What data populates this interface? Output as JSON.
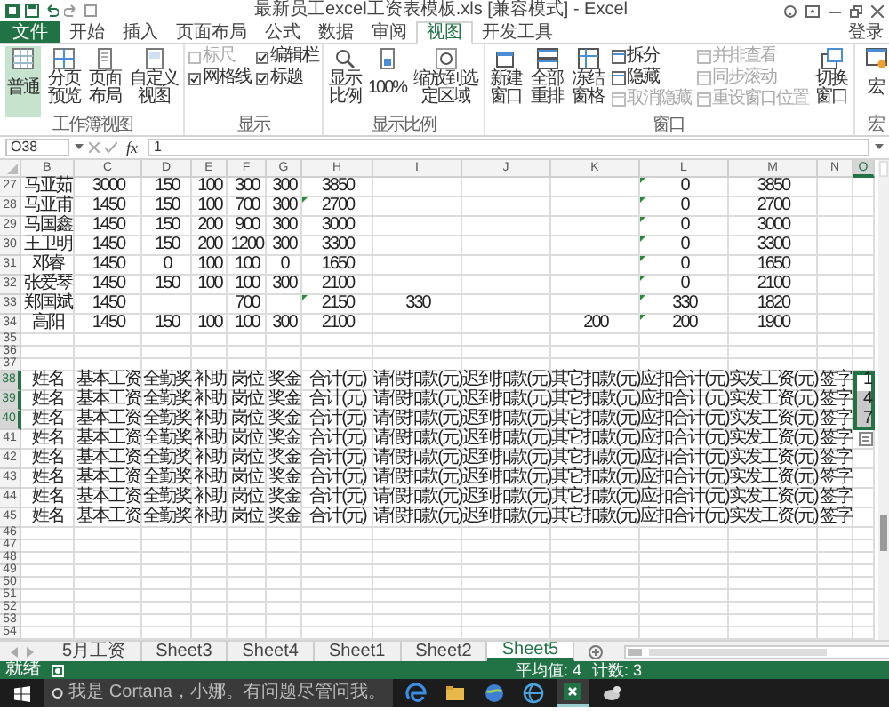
{
  "window": {
    "title": "最新员工excel工资表模板.xls  [兼容模式] - Excel"
  },
  "ribbon_tabs": [
    {
      "kind": "file",
      "label": "文件",
      "selected": false
    },
    {
      "kind": "tab",
      "label": "开始",
      "selected": false
    },
    {
      "kind": "tab",
      "label": "插入",
      "selected": false
    },
    {
      "kind": "tab",
      "label": "页面布局",
      "selected": false
    },
    {
      "kind": "tab",
      "label": "公式",
      "selected": false
    },
    {
      "kind": "tab",
      "label": "数据",
      "selected": false
    },
    {
      "kind": "tab",
      "label": "审阅",
      "selected": false
    },
    {
      "kind": "tab",
      "label": "视图",
      "selected": true
    },
    {
      "kind": "tab",
      "label": "开发工具",
      "selected": false
    }
  ],
  "account": "登录",
  "ribbon_groups": [
    {
      "items": [
        {
          "kind": "big",
          "label": "普通",
          "selected": true
        },
        {
          "kind": "big",
          "label": "分页预览",
          "selected": false
        },
        {
          "kind": "big",
          "label": "页面布局",
          "selected": false
        },
        {
          "kind": "big",
          "label": "自定义视图",
          "selected": false
        }
      ],
      "label": "工作簿视图"
    },
    {
      "items": [
        {
          "kind": "check",
          "label": "标尺",
          "checked": false,
          "disabled": true
        },
        {
          "kind": "check",
          "label": "网格线",
          "checked": true,
          "disabled": false
        },
        {
          "kind": "check",
          "label": "编辑栏",
          "checked": true,
          "disabled": false
        },
        {
          "kind": "check",
          "label": "标题",
          "checked": true,
          "disabled": false
        }
      ],
      "label": "显示"
    },
    {
      "items": [
        {
          "kind": "big",
          "label": "显示比例"
        },
        {
          "kind": "big",
          "label": "100%"
        },
        {
          "kind": "big",
          "label": "缩放到选定区域"
        }
      ],
      "label": "显示比例"
    },
    {
      "items": [
        {
          "kind": "big",
          "label": "新建窗口"
        },
        {
          "kind": "big",
          "label": "全部重排"
        },
        {
          "kind": "big",
          "label": "冻结窗格"
        },
        {
          "kind": "small",
          "label": "拆分",
          "disabled": false
        },
        {
          "kind": "small",
          "label": "隐藏",
          "disabled": false
        },
        {
          "kind": "small",
          "label": "取消隐藏",
          "disabled": true
        },
        {
          "kind": "small",
          "label": "并排查看",
          "disabled": true
        },
        {
          "kind": "small",
          "label": "同步滚动",
          "disabled": true
        },
        {
          "kind": "small",
          "label": "重设窗口位置",
          "disabled": true
        },
        {
          "kind": "big",
          "label": "切换窗口"
        }
      ],
      "label": "窗口"
    },
    {
      "items": [
        {
          "kind": "big",
          "label": "宏"
        }
      ],
      "label": "宏"
    }
  ],
  "formula_bar": {
    "name_box": "O38",
    "function_label": "fx",
    "value": "1"
  },
  "columns": [
    {
      "letter": "B",
      "selected": false
    },
    {
      "letter": "C",
      "selected": false
    },
    {
      "letter": "D",
      "selected": false
    },
    {
      "letter": "E",
      "selected": false
    },
    {
      "letter": "F",
      "selected": false
    },
    {
      "letter": "G",
      "selected": false
    },
    {
      "letter": "H",
      "selected": false
    },
    {
      "letter": "I",
      "selected": false
    },
    {
      "letter": "J",
      "selected": false
    },
    {
      "letter": "K",
      "selected": false
    },
    {
      "letter": "L",
      "selected": false
    },
    {
      "letter": "M",
      "selected": false
    },
    {
      "letter": "N",
      "selected": false
    },
    {
      "letter": "O",
      "selected": true
    }
  ],
  "rows": [
    {
      "number": "27",
      "selected": false,
      "cells": {
        "B": "马亚茹",
        "C": "3000",
        "D": "150",
        "E": "100",
        "F": "300",
        "G": "300",
        "H": "3850",
        "L": "0",
        "M": "3850"
      },
      "flags": {
        "L": true
      }
    },
    {
      "number": "28",
      "selected": false,
      "cells": {
        "B": "马亚甫",
        "C": "1450",
        "D": "150",
        "E": "100",
        "F": "700",
        "G": "300",
        "H": "2700",
        "L": "0",
        "M": "2700"
      },
      "flags": {
        "H": true,
        "L": true
      }
    },
    {
      "number": "29",
      "selected": false,
      "cells": {
        "B": "马国鑫",
        "C": "1450",
        "D": "150",
        "E": "200",
        "F": "900",
        "G": "300",
        "H": "3000",
        "L": "0",
        "M": "3000"
      },
      "flags": {
        "L": true
      }
    },
    {
      "number": "30",
      "selected": false,
      "cells": {
        "B": "王卫明",
        "C": "1450",
        "D": "150",
        "E": "200",
        "F": "1200",
        "G": "300",
        "H": "3300",
        "L": "0",
        "M": "3300"
      },
      "flags": {
        "L": true
      }
    },
    {
      "number": "31",
      "selected": false,
      "cells": {
        "B": "邓睿",
        "C": "1450",
        "D": "0",
        "E": "100",
        "F": "100",
        "G": "0",
        "H": "1650",
        "L": "0",
        "M": "1650"
      },
      "flags": {
        "L": true
      }
    },
    {
      "number": "32",
      "selected": false,
      "cells": {
        "B": "张爱琴",
        "C": "1450",
        "D": "150",
        "E": "100",
        "F": "100",
        "G": "300",
        "H": "2100",
        "L": "0",
        "M": "2100"
      },
      "flags": {
        "L": true
      }
    },
    {
      "number": "33",
      "selected": false,
      "cells": {
        "B": "郑国斌",
        "C": "1450",
        "F": "700",
        "H": "2150",
        "I": "330",
        "L": "330",
        "M": "1820"
      },
      "flags": {
        "H": true,
        "L": true
      }
    },
    {
      "number": "34",
      "selected": false,
      "cells": {
        "B": "高阳",
        "C": "1450",
        "D": "150",
        "E": "100",
        "F": "100",
        "G": "300",
        "H": "2100",
        "K": "200",
        "L": "200",
        "M": "1900"
      },
      "flags": {
        "L": true
      }
    },
    {
      "number": "35",
      "selected": false
    },
    {
      "number": "36",
      "selected": false
    },
    {
      "number": "37",
      "selected": false
    },
    {
      "number": "38",
      "selected": true,
      "cells": {
        "B": "姓名",
        "C": "基本工资",
        "D": "全勤奖",
        "E": "补助",
        "F": "岗位",
        "G": "奖金",
        "H": "合计(元)",
        "I": "请假扣款(元)",
        "J": "迟到扣款(元)",
        "K": "其它扣款(元)",
        "L": "应扣合计(元)",
        "M": "实发工资(元)",
        "N": "签字",
        "O": "1"
      }
    },
    {
      "number": "39",
      "selected": true,
      "cells": {
        "B": "姓名",
        "C": "基本工资",
        "D": "全勤奖",
        "E": "补助",
        "F": "岗位",
        "G": "奖金",
        "H": "合计(元)",
        "I": "请假扣款(元)",
        "J": "迟到扣款(元)",
        "K": "其它扣款(元)",
        "L": "应扣合计(元)",
        "M": "实发工资(元)",
        "N": "签字",
        "O": "4"
      }
    },
    {
      "number": "40",
      "selected": true,
      "cells": {
        "B": "姓名",
        "C": "基本工资",
        "D": "全勤奖",
        "E": "补助",
        "F": "岗位",
        "G": "奖金",
        "H": "合计(元)",
        "I": "请假扣款(元)",
        "J": "迟到扣款(元)",
        "K": "其它扣款(元)",
        "L": "应扣合计(元)",
        "M": "实发工资(元)",
        "N": "签字",
        "O": "7"
      }
    },
    {
      "number": "41",
      "selected": false,
      "cells": {
        "B": "姓名",
        "C": "基本工资",
        "D": "全勤奖",
        "E": "补助",
        "F": "岗位",
        "G": "奖金",
        "H": "合计(元)",
        "I": "请假扣款(元)",
        "J": "迟到扣款(元)",
        "K": "其它扣款(元)",
        "L": "应扣合计(元)",
        "M": "实发工资(元)",
        "N": "签字"
      }
    },
    {
      "number": "42",
      "selected": false,
      "cells": {
        "B": "姓名",
        "C": "基本工资",
        "D": "全勤奖",
        "E": "补助",
        "F": "岗位",
        "G": "奖金",
        "H": "合计(元)",
        "I": "请假扣款(元)",
        "J": "迟到扣款(元)",
        "K": "其它扣款(元)",
        "L": "应扣合计(元)",
        "M": "实发工资(元)",
        "N": "签字"
      }
    },
    {
      "number": "43",
      "selected": false,
      "cells": {
        "B": "姓名",
        "C": "基本工资",
        "D": "全勤奖",
        "E": "补助",
        "F": "岗位",
        "G": "奖金",
        "H": "合计(元)",
        "I": "请假扣款(元)",
        "J": "迟到扣款(元)",
        "K": "其它扣款(元)",
        "L": "应扣合计(元)",
        "M": "实发工资(元)",
        "N": "签字"
      }
    },
    {
      "number": "44",
      "selected": false,
      "cells": {
        "B": "姓名",
        "C": "基本工资",
        "D": "全勤奖",
        "E": "补助",
        "F": "岗位",
        "G": "奖金",
        "H": "合计(元)",
        "I": "请假扣款(元)",
        "J": "迟到扣款(元)",
        "K": "其它扣款(元)",
        "L": "应扣合计(元)",
        "M": "实发工资(元)",
        "N": "签字"
      }
    },
    {
      "number": "45",
      "selected": false,
      "cells": {
        "B": "姓名",
        "C": "基本工资",
        "D": "全勤奖",
        "E": "补助",
        "F": "岗位",
        "G": "奖金",
        "H": "合计(元)",
        "I": "请假扣款(元)",
        "J": "迟到扣款(元)",
        "K": "其它扣款(元)",
        "L": "应扣合计(元)",
        "M": "实发工资(元)",
        "N": "签字"
      }
    },
    {
      "number": "46",
      "selected": false
    },
    {
      "number": "47",
      "selected": false
    },
    {
      "number": "48",
      "selected": false
    },
    {
      "number": "49",
      "selected": false
    },
    {
      "number": "50",
      "selected": false
    },
    {
      "number": "51",
      "selected": false
    },
    {
      "number": "52",
      "selected": false
    },
    {
      "number": "53",
      "selected": false
    },
    {
      "number": "54",
      "selected": false
    }
  ],
  "sheet_tabs": [
    {
      "label": "5月工资",
      "selected": false
    },
    {
      "label": "Sheet3",
      "selected": false
    },
    {
      "label": "Sheet4",
      "selected": false
    },
    {
      "label": "Sheet1",
      "selected": false
    },
    {
      "label": "Sheet2",
      "selected": false
    },
    {
      "label": "Sheet5",
      "selected": true
    }
  ],
  "status_bar": {
    "mode": "就绪",
    "stats": [
      "平均值: 4",
      "计数: 3"
    ]
  },
  "taskbar": {
    "search": {
      "placeholder": "我是 Cortana，小娜。有问题尽管问我。"
    },
    "apps": [
      {
        "active": false
      },
      {
        "active": false
      },
      {
        "active": false
      },
      {
        "active": false
      },
      {
        "active": true
      },
      {
        "active": false
      }
    ]
  }
}
